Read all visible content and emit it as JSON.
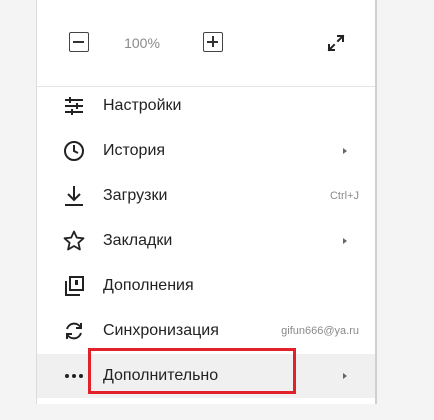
{
  "zoom": {
    "value": "100%",
    "decrease_icon": "minus-icon",
    "increase_icon": "plus-icon",
    "fullscreen_icon": "fullscreen-icon"
  },
  "menu": {
    "items": [
      {
        "label": "Настройки",
        "icon": "settings-sliders-icon"
      },
      {
        "label": "История",
        "icon": "clock-icon",
        "submenu": true
      },
      {
        "label": "Загрузки",
        "icon": "download-icon",
        "shortcut": "Ctrl+J"
      },
      {
        "label": "Закладки",
        "icon": "star-icon",
        "submenu": true
      },
      {
        "label": "Дополнения",
        "icon": "extensions-icon"
      },
      {
        "label": "Синхронизация",
        "icon": "sync-icon",
        "account": "gifun666@ya.ru"
      },
      {
        "label": "Дополнительно",
        "icon": "more-dots-icon",
        "submenu": true,
        "highlighted": true
      }
    ]
  },
  "colors": {
    "highlight_border": "#e32129",
    "hover_background": "#f0f0f0",
    "secondary_text": "#8a8a8a"
  }
}
